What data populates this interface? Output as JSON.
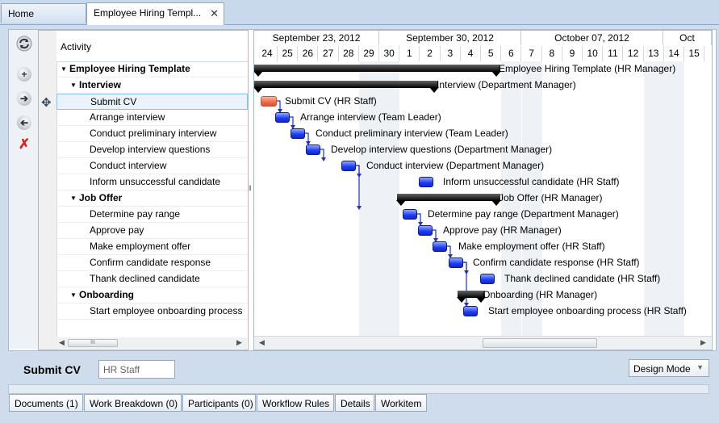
{
  "tabs": [
    {
      "label": "Home",
      "active": false
    },
    {
      "label": "Employee Hiring Templ...",
      "active": true,
      "close": "✕"
    }
  ],
  "toolbar": {
    "refresh_icon": "refresh-icon",
    "add_icon": "add-icon",
    "indent_icon": "indent-right-icon",
    "outdent_icon": "outdent-left-icon",
    "delete_icon": "delete-icon"
  },
  "grid": {
    "header": "Activity",
    "rows": [
      {
        "label": "Employee Hiring Template",
        "level": 0,
        "summary": true
      },
      {
        "label": "Interview",
        "level": 1,
        "summary": true
      },
      {
        "label": "Submit CV",
        "level": 2,
        "summary": false,
        "selected": true
      },
      {
        "label": "Arrange interview",
        "level": 2,
        "summary": false
      },
      {
        "label": "Conduct preliminary interview",
        "level": 2,
        "summary": false
      },
      {
        "label": "Develop interview questions",
        "level": 2,
        "summary": false
      },
      {
        "label": "Conduct interview",
        "level": 2,
        "summary": false
      },
      {
        "label": "Inform unsuccessful candidate",
        "level": 2,
        "summary": false
      },
      {
        "label": "Job Offer",
        "level": 1,
        "summary": true
      },
      {
        "label": "Determine pay range",
        "level": 2,
        "summary": false
      },
      {
        "label": "Approve pay",
        "level": 2,
        "summary": false
      },
      {
        "label": "Make employment offer",
        "level": 2,
        "summary": false
      },
      {
        "label": "Confirm candidate response",
        "level": 2,
        "summary": false
      },
      {
        "label": "Thank declined candidate",
        "level": 2,
        "summary": false
      },
      {
        "label": "Onboarding",
        "level": 1,
        "summary": true
      },
      {
        "label": "Start employee onboarding process",
        "level": 2,
        "summary": false
      }
    ],
    "scroll_mark": "III"
  },
  "gantt": {
    "weeks": [
      "September 23, 2012",
      "September 30, 2012",
      "October 07, 2012",
      "Oct"
    ],
    "days": [
      "24",
      "25",
      "26",
      "27",
      "28",
      "29",
      "30",
      "1",
      "2",
      "3",
      "4",
      "5",
      "6",
      "7",
      "8",
      "9",
      "10",
      "11",
      "12",
      "13",
      "14",
      "15",
      "1"
    ],
    "bars": [
      {
        "label": "Employee Hiring Template (HR Manager)",
        "type": "summary"
      },
      {
        "label": "Interview (Department Manager)",
        "type": "summary"
      },
      {
        "label": "Submit CV (HR Staff)",
        "type": "task",
        "color": "#f06a4a"
      },
      {
        "label": "Arrange interview (Team Leader)",
        "type": "task"
      },
      {
        "label": "Conduct preliminary interview (Team Leader)",
        "type": "task"
      },
      {
        "label": "Develop interview questions (Department Manager)",
        "type": "task"
      },
      {
        "label": "Conduct interview (Department Manager)",
        "type": "task"
      },
      {
        "label": "Inform unsuccessful candidate (HR Staff)",
        "type": "task"
      },
      {
        "label": "Job Offer (HR Manager)",
        "type": "summary"
      },
      {
        "label": "Determine pay range (Department Manager)",
        "type": "task"
      },
      {
        "label": "Approve pay (HR Manager)",
        "type": "task"
      },
      {
        "label": "Make employment offer (HR Staff)",
        "type": "task"
      },
      {
        "label": "Confirm candidate response (HR Staff)",
        "type": "task"
      },
      {
        "label": "Thank declined candidate (HR Staff)",
        "type": "task"
      },
      {
        "label": "Onboarding (HR Manager)",
        "type": "summary"
      },
      {
        "label": "Start employee onboarding process (HR Staff)",
        "type": "task"
      }
    ]
  },
  "details": {
    "title": "Submit CV",
    "participant_value": "HR Staff",
    "mode_selected": "Design Mode"
  },
  "bottom_tabs": [
    "Documents (1)",
    "Work Breakdown (0)",
    "Participants (0)",
    "Workflow Rules",
    "Details",
    "Workitem"
  ],
  "colors": {
    "task_bar": "#1c3bf0",
    "selected_task_bar": "#f06a4a",
    "summary_bar": "#000000",
    "weekend": "#eef1f6"
  }
}
